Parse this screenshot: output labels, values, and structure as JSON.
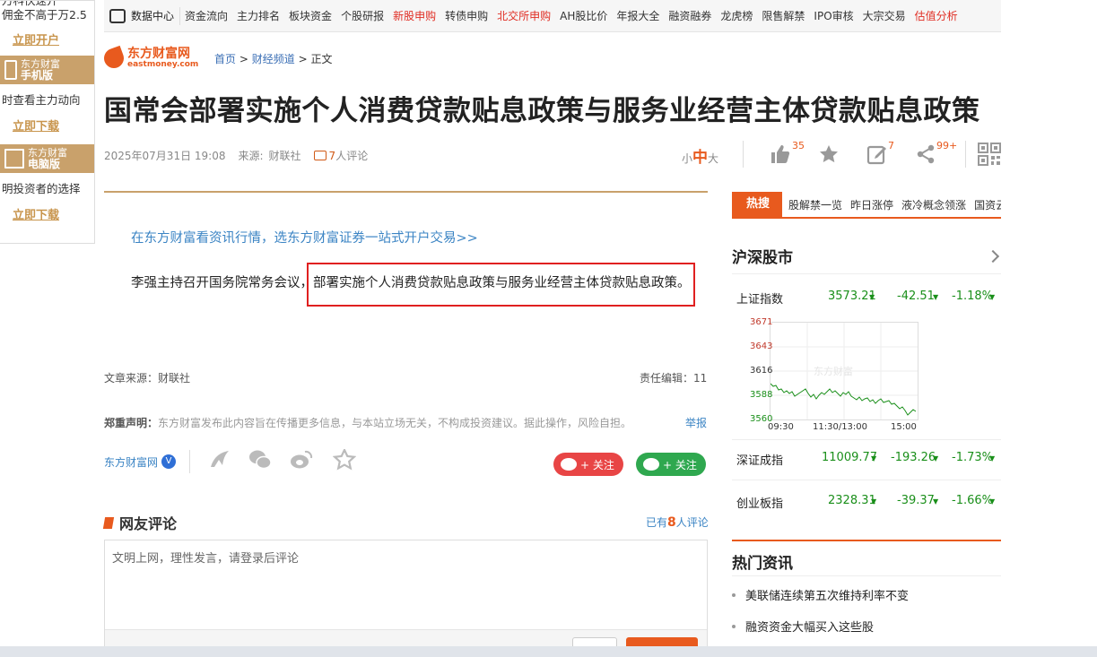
{
  "left_promo": {
    "top_line_1": "万科快速开",
    "top_line_2": "佣金不高于万2.5",
    "open_link": "立即开户",
    "mobile_band_1": "东方财富",
    "mobile_band_2": "手机版",
    "mobile_desc": "时查看主力动向",
    "mobile_link": "立即下载",
    "pc_band_1": "东方财富",
    "pc_band_2": "电脑版",
    "pc_desc": "明投资者的选择",
    "pc_link": "立即下载"
  },
  "topnav": {
    "home_label": "数据中心",
    "items": [
      "资金流向",
      "主力排名",
      "板块资金",
      "个股研报",
      "新股申购",
      "转债申购",
      "北交所申购",
      "AH股比价",
      "年报大全",
      "融资融券",
      "龙虎榜",
      "限售解禁",
      "IPO审核",
      "大宗交易",
      "估值分析"
    ],
    "red_items": [
      "新股申购",
      "北交所申购",
      "估值分析"
    ]
  },
  "logo": {
    "cn": "东方财富网",
    "en": "eastmoney.com"
  },
  "breadcrumb": {
    "home": "首页",
    "sep": ">",
    "channel": "财经频道",
    "current": "正文"
  },
  "article": {
    "title": "国常会部署实施个人消费贷款贴息政策与服务业经营主体贷款贴息政策",
    "datetime": "2025年07月31日 19:08",
    "source_label": "来源:",
    "source": "财联社",
    "comments": "7",
    "comments_suffix": "人评论",
    "font_small": "小",
    "font_mid": "中",
    "font_large": "大",
    "like_count": "35",
    "edit_count": "7",
    "share_count": "99+",
    "lede": "在东方财富看资讯行情，选东方财富证券一站式开户交易>>",
    "body": "李强主持召开国务院常务会议，部署实施个人消费贷款贴息政策与服务业经营主体贷款贴息政策。",
    "article_source": "文章来源：财联社",
    "editor": "责任编辑：11",
    "disclaimer_label": "郑重声明：",
    "disclaimer": "东方财富发布此内容旨在传播更多信息，与本站立场无关，不构成投资建议。据此操作，风险自担。",
    "report": "举报",
    "author": "东方财富网",
    "verified": "V",
    "follow_weibo": "+ 关注",
    "follow_wechat": "+ 关注"
  },
  "comments_section": {
    "heading": "网友评论",
    "count_prefix": "已有",
    "count": "8",
    "count_suffix": "人评论",
    "placeholder": "文明上网，理性发言，请登录后评论"
  },
  "hot_search": {
    "tag": "热搜",
    "items": [
      "股解禁一览",
      "昨日涨停",
      "液冷概念领涨",
      "国资云"
    ]
  },
  "market": {
    "heading": "沪深股市",
    "indices": [
      {
        "name": "上证指数",
        "price": "3573.21",
        "change": "-42.51",
        "pct": "-1.18%"
      },
      {
        "name": "深证成指",
        "price": "11009.77",
        "change": "-193.26",
        "pct": "-1.73%"
      },
      {
        "name": "创业板指",
        "price": "2328.31",
        "change": "-39.37",
        "pct": "-1.66%"
      }
    ],
    "chart_y_labels": [
      "3671",
      "3643",
      "3616",
      "3588",
      "3560"
    ],
    "chart_x_labels": [
      "09:30",
      "11:30/13:00",
      "15:00"
    ],
    "chart_watermark": "东方财富"
  },
  "hot_news": {
    "heading": "热门资讯",
    "items": [
      "美联储连续第五次维持利率不变",
      "融资资金大幅买入这些股"
    ]
  },
  "colors": {
    "brand": "#e85a1e",
    "down": "#1a8f1a",
    "link": "#3b84c4",
    "highlight": "#e02020"
  }
}
